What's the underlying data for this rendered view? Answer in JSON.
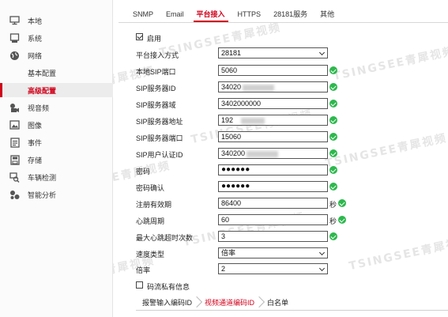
{
  "sidebar": {
    "items": [
      {
        "label": "本地",
        "icon": "monitor-icon"
      },
      {
        "label": "系统",
        "icon": "system-icon"
      },
      {
        "label": "网络",
        "icon": "globe-icon"
      },
      {
        "label": "基本配置",
        "icon": ""
      },
      {
        "label": "高级配置",
        "icon": ""
      },
      {
        "label": "视音频",
        "icon": "video-icon"
      },
      {
        "label": "图像",
        "icon": "image-icon"
      },
      {
        "label": "事件",
        "icon": "event-icon"
      },
      {
        "label": "存储",
        "icon": "storage-icon"
      },
      {
        "label": "车辆检测",
        "icon": "vehicle-search-icon"
      },
      {
        "label": "智能分析",
        "icon": "analysis-icon"
      }
    ]
  },
  "tabs": [
    "SNMP",
    "Email",
    "平台接入",
    "HTTPS",
    "28181服务",
    "其他"
  ],
  "form": {
    "enable_label": "启用",
    "access_mode": {
      "label": "平台接入方式",
      "value": "28181"
    },
    "local_sip_port": {
      "label": "本地SIP端口",
      "value": "5060"
    },
    "sip_server_id": {
      "label": "SIP服务器ID",
      "value": "34020"
    },
    "sip_server_domain": {
      "label": "SIP服务器域",
      "value": "3402000000"
    },
    "sip_server_addr": {
      "label": "SIP服务器地址",
      "value": "192"
    },
    "sip_server_port": {
      "label": "SIP服务器端口",
      "value": "15060"
    },
    "sip_user_auth_id": {
      "label": "SIP用户认证ID",
      "value": "340200"
    },
    "password": {
      "label": "密码",
      "value": "●●●●●●"
    },
    "password_confirm": {
      "label": "密码确认",
      "value": "●●●●●●"
    },
    "register_validity": {
      "label": "注册有效期",
      "value": "86400",
      "unit": "秒"
    },
    "heartbeat_period": {
      "label": "心跳周期",
      "value": "60",
      "unit": "秒"
    },
    "max_heartbeat_timeout": {
      "label": "最大心跳超时次数",
      "value": "3"
    },
    "speed_type": {
      "label": "速度类型",
      "value": "倍率"
    },
    "rate": {
      "label": "倍率",
      "value": "2"
    },
    "private_info_label": "码流私有信息"
  },
  "subtabs": [
    "报警输入编码ID",
    "视频通道编码ID",
    "白名单"
  ],
  "watermark": "TSINGSEE青犀视频",
  "colors": {
    "accent": "#d0021b",
    "ok": "#2db84d"
  }
}
